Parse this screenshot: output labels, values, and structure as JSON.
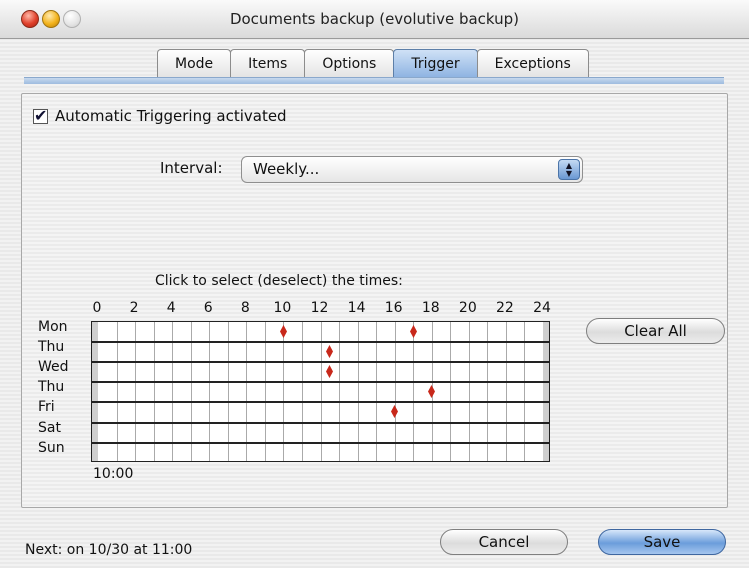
{
  "window": {
    "title": "Documents backup (evolutive backup)",
    "buttons": [
      "close",
      "minimize",
      "zoom"
    ]
  },
  "tabs": [
    {
      "label": "Mode",
      "active": false
    },
    {
      "label": "Items",
      "active": false
    },
    {
      "label": "Options",
      "active": false
    },
    {
      "label": "Trigger",
      "active": true
    },
    {
      "label": "Exceptions",
      "active": false
    }
  ],
  "trigger": {
    "automatic_label": "Automatic Triggering activated",
    "automatic_checked": true,
    "interval_label": "Interval:",
    "interval_value": "Weekly...",
    "caption": "Click to select (deselect) the times:",
    "hour_labels": [
      "0",
      "2",
      "4",
      "6",
      "8",
      "10",
      "12",
      "14",
      "16",
      "18",
      "20",
      "22",
      "24"
    ],
    "day_labels": [
      "Mon",
      "Thu",
      "Wed",
      "Thu",
      "Fri",
      "Sat",
      "Sun"
    ],
    "selected_times": [
      {
        "day": 0,
        "hour": 10
      },
      {
        "day": 0,
        "hour": 17
      },
      {
        "day": 1,
        "hour": 12.5
      },
      {
        "day": 2,
        "hour": 12.5
      },
      {
        "day": 3,
        "hour": 18
      },
      {
        "day": 4,
        "hour": 16
      }
    ],
    "time_readout": "10:00",
    "clear_all_label": "Clear All",
    "marker_color": "#c8281b"
  },
  "footer": {
    "status": "Next: on 10/30 at 11:00",
    "cancel_label": "Cancel",
    "save_label": "Save"
  }
}
